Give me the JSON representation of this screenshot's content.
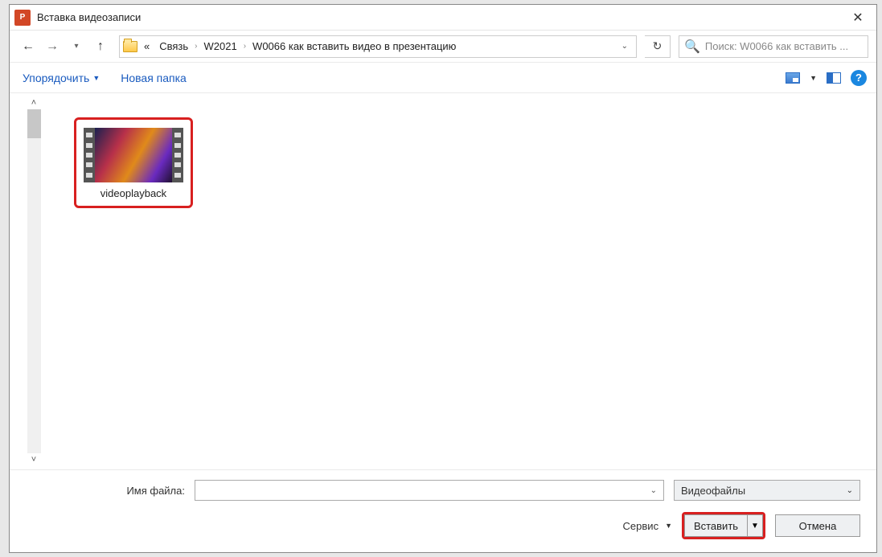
{
  "title": "Вставка видеозаписи",
  "breadcrumb": {
    "prefix": "«",
    "items": [
      "Связь",
      "W2021",
      "W0066 как вставить видео в презентацию"
    ]
  },
  "search": {
    "placeholder": "Поиск: W0066 как вставить ..."
  },
  "toolbar": {
    "organize": "Упорядочить",
    "newfolder": "Новая папка"
  },
  "file": {
    "name": "videoplayback"
  },
  "form": {
    "filename_label": "Имя файла:",
    "filter": "Видеофайлы",
    "service": "Сервис",
    "insert": "Вставить",
    "cancel": "Отмена"
  },
  "help_glyph": "?"
}
